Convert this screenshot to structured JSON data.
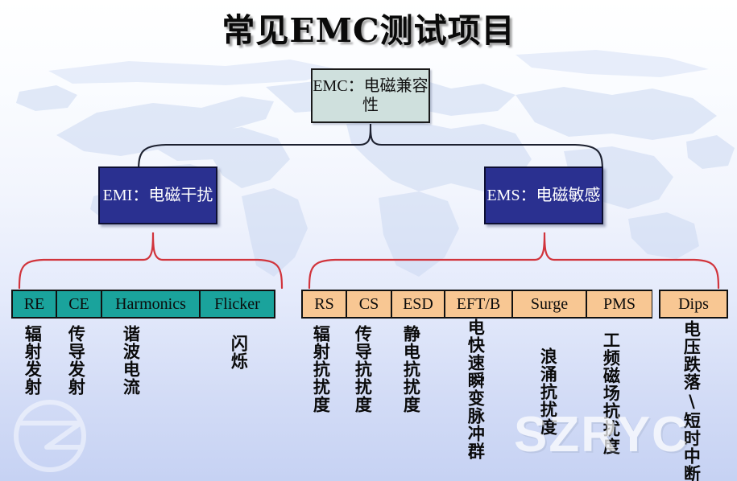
{
  "title": "常见EMC测试项目",
  "root": {
    "label": "EMC：电磁兼容性"
  },
  "branches": {
    "emi": {
      "label": "EMI：电磁干扰"
    },
    "ems": {
      "label": "EMS：电磁敏感"
    }
  },
  "emi_items": [
    {
      "code": "RE",
      "caption": "辐射发射"
    },
    {
      "code": "CE",
      "caption": "传导发射"
    },
    {
      "code": "Harmonics",
      "caption": "谐波电流"
    },
    {
      "code": "Flicker",
      "caption": "闪烁"
    }
  ],
  "ems_items": [
    {
      "code": "RS",
      "caption": "辐射抗扰度"
    },
    {
      "code": "CS",
      "caption": "传导抗扰度"
    },
    {
      "code": "ESD",
      "caption": "静电抗扰度"
    },
    {
      "code": "EFT/B",
      "caption": "电快速瞬变脉冲群"
    },
    {
      "code": "Surge",
      "caption": "浪涌抗扰度"
    },
    {
      "code": "PMS",
      "caption": "工频磁场抗扰度"
    },
    {
      "code": "Dips",
      "caption": "电压跌落\\短时中断"
    }
  ],
  "watermark": {
    "text": "SZRYC"
  },
  "colors": {
    "emc_box": "#cfe0dd",
    "branch_box": "#2a3090",
    "emi_cell": "#1aa39c",
    "ems_cell": "#f8c793",
    "brace_red": "#d1343c",
    "brace_dark": "#1d2130"
  }
}
